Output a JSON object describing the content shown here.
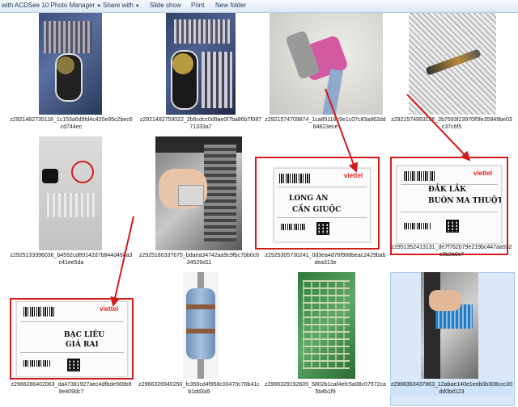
{
  "toolbar": {
    "items": [
      "with ACDSee 10 Photo Manager",
      "Share with",
      "Slide show",
      "Print",
      "New folder"
    ]
  },
  "files": [
    {
      "name": "z2921482735118_1c153a6d9fd4c420e95c2bec6cd744ec"
    },
    {
      "name": "z2921482759022_2b6cdcc0d9ae0f7ba86b7f08771333a7"
    },
    {
      "name": "z2921574709874_1ca85118c9e1c07c83a862dd84823ece"
    },
    {
      "name": "z2921574993196_2b7593f23970f5fe35949be03c37c6f5"
    },
    {
      "name": "z2925133396036_b4592cd89142d7b844d468a3c41ee5da"
    },
    {
      "name": "z2925160337675_bdaea34742aa9c9fbc7bb0c634529d11"
    },
    {
      "name": "z2925305730241_0d3ea4d76f988beac2429babdea313e"
    },
    {
      "name": "z2951352413131_de7f762b79e219bc447aa932c3b2a0c7"
    },
    {
      "name": "z2966286402063_da47381927aec4dfbde569b99e409dc7"
    },
    {
      "name": "z2966326940250_fc359cd4f958c00470c70b41cb1dd3a5"
    },
    {
      "name": "z2966329192605_5802b1caf4efc5a08c07572ca5b4b1f9"
    },
    {
      "name": "z2966363437863_12abae140e1eeb0b308ccc30dd0bd123"
    }
  ],
  "labels": [
    {
      "brand": "viettel",
      "line1": "LONG AN",
      "line2": "CẦN GIUỘC"
    },
    {
      "brand": "viettel",
      "line1": "ĐẮK LẮK",
      "line2": "BUÔN MA THUỘT"
    },
    {
      "brand": "viettel",
      "line1": "BẠC LIÊU",
      "line2": "GIÁ RAI"
    }
  ],
  "colors": {
    "annotation": "#d41b1b",
    "selection": "#dbe8f8"
  }
}
